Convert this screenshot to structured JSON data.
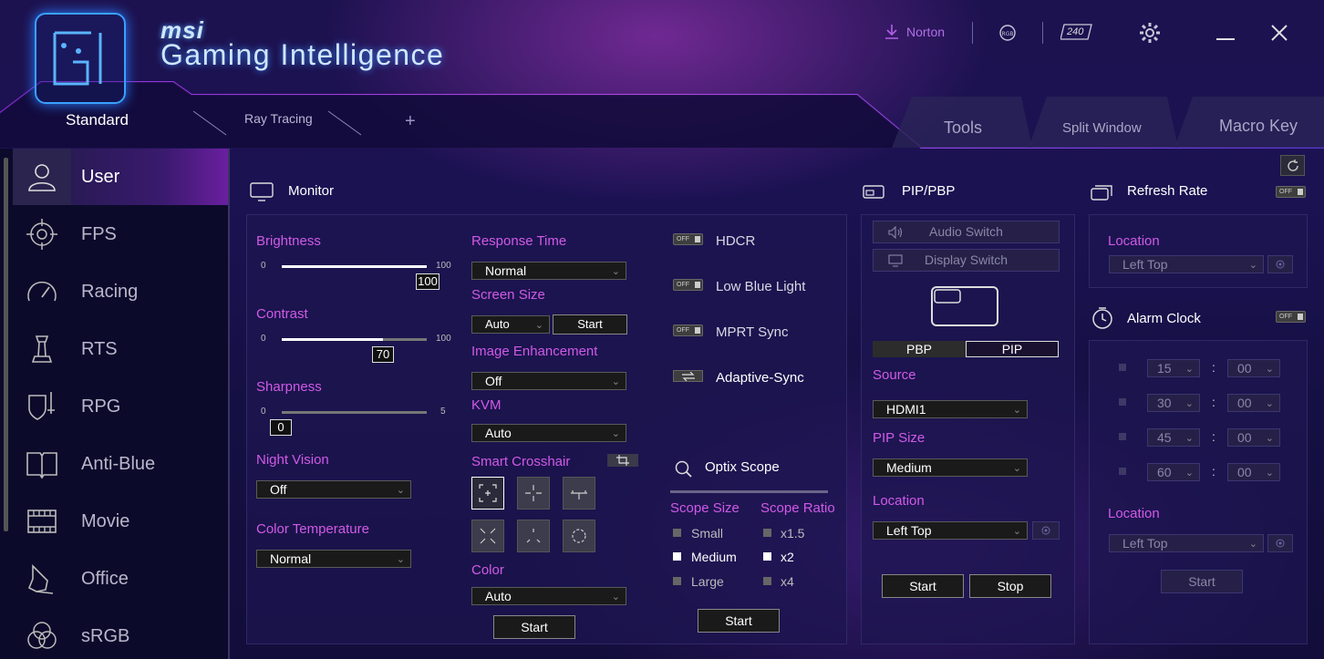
{
  "brand": {
    "msi": "msi",
    "app_title": "Gaming Intelligence"
  },
  "titlebar": {
    "norton": "Norton",
    "hz": "240"
  },
  "tabs": {
    "standard": "Standard",
    "ray_tracing": "Ray Tracing",
    "add": "+",
    "tools": "Tools",
    "split_window": "Split Window",
    "macro_key": "Macro Key"
  },
  "sidebar": [
    {
      "label": "User",
      "icon": "user-icon"
    },
    {
      "label": "FPS",
      "icon": "crosshair-icon"
    },
    {
      "label": "Racing",
      "icon": "speedometer-icon"
    },
    {
      "label": "RTS",
      "icon": "chess-icon"
    },
    {
      "label": "RPG",
      "icon": "shield-sword-icon"
    },
    {
      "label": "Anti-Blue",
      "icon": "book-icon"
    },
    {
      "label": "Movie",
      "icon": "film-icon"
    },
    {
      "label": "Office",
      "icon": "pen-icon"
    },
    {
      "label": "sRGB",
      "icon": "rgb-circles-icon"
    }
  ],
  "monitor": {
    "title": "Monitor",
    "brightness": {
      "label": "Brightness",
      "min": "0",
      "max": "100",
      "value": "100",
      "fraction": 1.0
    },
    "contrast": {
      "label": "Contrast",
      "min": "0",
      "max": "100",
      "value": "70",
      "fraction": 0.7
    },
    "sharpness": {
      "label": "Sharpness",
      "min": "0",
      "max": "5",
      "value": "0",
      "fraction": 0
    },
    "night_vision": {
      "label": "Night Vision",
      "value": "Off"
    },
    "color_temperature": {
      "label": "Color Temperature",
      "value": "Normal"
    },
    "response_time": {
      "label": "Response Time",
      "value": "Normal"
    },
    "screen_size": {
      "label": "Screen Size",
      "value": "Auto",
      "button": "Start"
    },
    "image_enhancement": {
      "label": "Image Enhancement",
      "value": "Off"
    },
    "kvm": {
      "label": "KVM",
      "value": "Auto"
    },
    "smart_crosshair": {
      "label": "Smart Crosshair"
    },
    "color": {
      "label": "Color",
      "value": "Auto",
      "button": "Start"
    },
    "toggle_off_text": "OFF",
    "hdcr": "HDCR",
    "low_blue_light": "Low Blue Light",
    "mprt_sync": "MPRT Sync",
    "adaptive_sync": "Adaptive-Sync"
  },
  "optix_scope": {
    "title": "Optix Scope",
    "scope_size": {
      "label": "Scope Size",
      "options": [
        "Small",
        "Medium",
        "Large"
      ],
      "selected": "Medium"
    },
    "scope_ratio": {
      "label": "Scope Ratio",
      "options": [
        "x1.5",
        "x2",
        "x4"
      ],
      "selected": "x2"
    },
    "button": "Start"
  },
  "pip": {
    "title": "PIP/PBP",
    "audio_switch": "Audio Switch",
    "display_switch": "Display Switch",
    "pbp": "PBP",
    "pip": "PIP",
    "active_mode": "PIP",
    "source": {
      "label": "Source",
      "value": "HDMI1"
    },
    "pip_size": {
      "label": "PIP Size",
      "value": "Medium"
    },
    "location": {
      "label": "Location",
      "value": "Left Top"
    },
    "start": "Start",
    "stop": "Stop"
  },
  "refresh_rate": {
    "title": "Refresh Rate",
    "location_label": "Location",
    "location_value": "Left Top"
  },
  "alarm_clock": {
    "title": "Alarm Clock",
    "alarms": [
      {
        "min": "15",
        "sec": "00"
      },
      {
        "min": "30",
        "sec": "00"
      },
      {
        "min": "45",
        "sec": "00"
      },
      {
        "min": "60",
        "sec": "00"
      }
    ],
    "separator": ":",
    "location_label": "Location",
    "location_value": "Left Top",
    "button": "Start"
  },
  "colors": {
    "accent": "#d05ae6",
    "brand_blue": "#3aa0ff",
    "bg": "#151044"
  }
}
